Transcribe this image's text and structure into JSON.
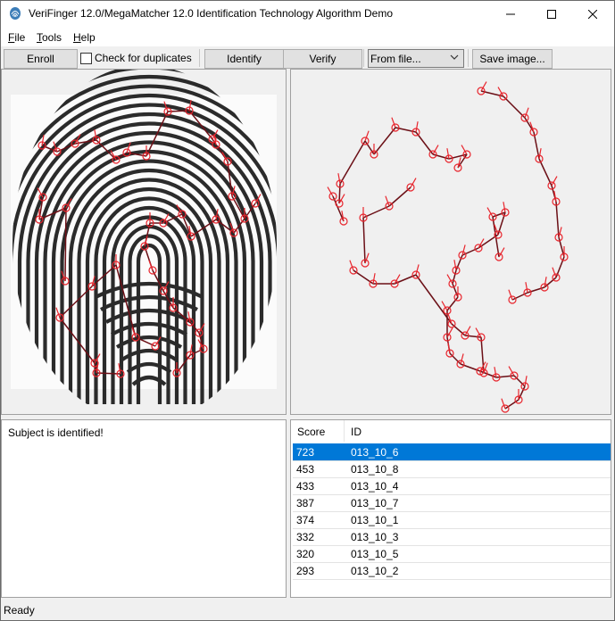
{
  "title": "VeriFinger 12.0/MegaMatcher 12.0 Identification Technology Algorithm Demo",
  "window_controls": {
    "minimize": "—",
    "maximize": "☐",
    "close": "✕"
  },
  "menu": [
    "File",
    "Tools",
    "Help"
  ],
  "toolbar": {
    "enroll": "Enroll",
    "check_duplicates": "Check for duplicates",
    "identify": "Identify",
    "verify": "Verify",
    "source": "From file...",
    "save_image": "Save image..."
  },
  "message": "Subject is identified!",
  "results": {
    "columns": [
      "Score",
      "ID"
    ],
    "rows": [
      {
        "score": "723",
        "id": "013_10_6",
        "selected": true
      },
      {
        "score": "453",
        "id": "013_10_8"
      },
      {
        "score": "433",
        "id": "013_10_4"
      },
      {
        "score": "387",
        "id": "013_10_7"
      },
      {
        "score": "374",
        "id": "013_10_1"
      },
      {
        "score": "332",
        "id": "013_10_3"
      },
      {
        "score": "320",
        "id": "013_10_5"
      },
      {
        "score": "293",
        "id": "013_10_2"
      }
    ]
  },
  "status": "Ready",
  "colors": {
    "minutia": "#e8242c",
    "link": "#6b0f16",
    "selection": "#0078d7"
  }
}
